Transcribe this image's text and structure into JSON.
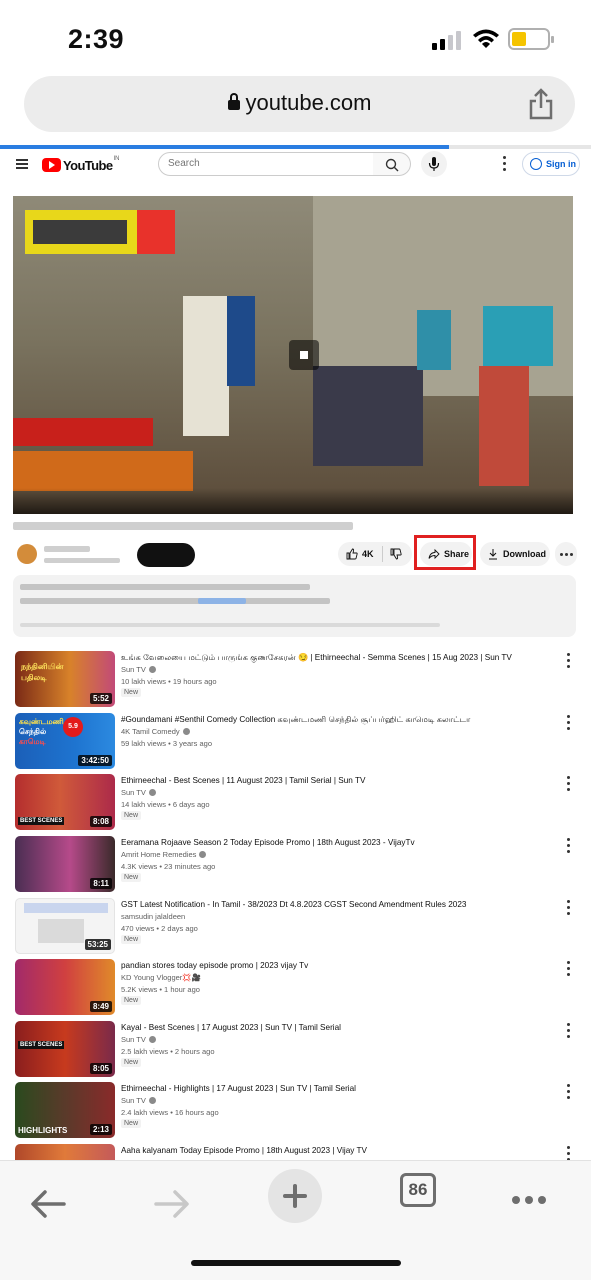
{
  "status_bar": {
    "time": "2:39"
  },
  "browser": {
    "url": "youtube.com",
    "tab_count": "86"
  },
  "yt_header": {
    "logo_text": "YouTube",
    "logo_region": "IN",
    "search_placeholder": "Search",
    "sign_in_label": "Sign in"
  },
  "video": {
    "like_count": "4K",
    "share_label": "Share",
    "download_label": "Download"
  },
  "recommendations": [
    {
      "title": "உங்க வேலையை மட்டும் பாருங்க குணசேகரன் 😏 | Ethirneechal - Semma Scenes | 15 Aug 2023 | Sun TV",
      "channel": "Sun TV",
      "verified": true,
      "meta": "10 lakh views • 19 hours ago",
      "badge": "New",
      "duration": "5:52"
    },
    {
      "title": "#Goundamani #Senthil Comedy Collection கவுண்டமணி செந்தில் சூப்பர்ஹிட் காமெடி கலாட்டா",
      "channel": "4K Tamil Comedy",
      "verified": true,
      "meta": "59 lakh views • 3 years ago",
      "badge": "",
      "duration": "3:42:50"
    },
    {
      "title": "Ethirneechal - Best Scenes | 11 August 2023 | Tamil Serial | Sun TV",
      "channel": "Sun TV",
      "verified": true,
      "meta": "14 lakh views • 6 days ago",
      "badge": "New",
      "duration": "8:08"
    },
    {
      "title": "Eeramana Rojaave Season 2 Today Episode Promo | 18th August 2023 - VijayTv",
      "channel": "Amrit Home Remedies",
      "verified": true,
      "meta": "4.3K views • 23 minutes ago",
      "badge": "New",
      "duration": "8:11"
    },
    {
      "title": "GST Latest Notification - In Tamil - 38/2023 Dt 4.8.2023 CGST Second Amendment Rules 2023",
      "channel": "samsudin jalaldeen",
      "verified": false,
      "meta": "470 views • 2 days ago",
      "badge": "New",
      "duration": "53:25"
    },
    {
      "title": "pandian stores today episode promo | 2023 vijay Tv",
      "channel": "KD Young Vlogger💢🎥",
      "verified": false,
      "meta": "5.2K views • 1 hour ago",
      "badge": "New",
      "duration": "8:49"
    },
    {
      "title": "Kayal - Best Scenes | 17 August 2023 | Sun TV | Tamil Serial",
      "channel": "Sun TV",
      "verified": true,
      "meta": "2.5 lakh views • 2 hours ago",
      "badge": "New",
      "duration": "8:05"
    },
    {
      "title": "Ethirneechal - Highlights | 17 August 2023 | Sun TV | Tamil Serial",
      "channel": "Sun TV",
      "verified": true,
      "meta": "2.4 lakh views • 16 hours ago",
      "badge": "New",
      "duration": "2:13"
    },
    {
      "title": "Aaha kalyanam Today Episode Promo | 18th August 2023 | Vijay TV",
      "channel": "",
      "verified": false,
      "meta": "",
      "badge": "",
      "duration": ""
    }
  ],
  "thumb_overlays": {
    "t0": [
      "நந்தினியின்",
      "பதிலடி"
    ],
    "t1": [
      "கவுண்டமணி",
      "செந்தில்",
      "காமெடி",
      "5.9"
    ],
    "t2": [
      "BEST SCENES"
    ],
    "t6": [
      "BEST SCENES"
    ],
    "t7": [
      "HIGHLIGHTS"
    ]
  },
  "colors": {
    "accent_red": "#e02020",
    "link_blue": "#065fd4",
    "youtube_red": "#ff0000"
  },
  "page_load_progress": 0.76
}
